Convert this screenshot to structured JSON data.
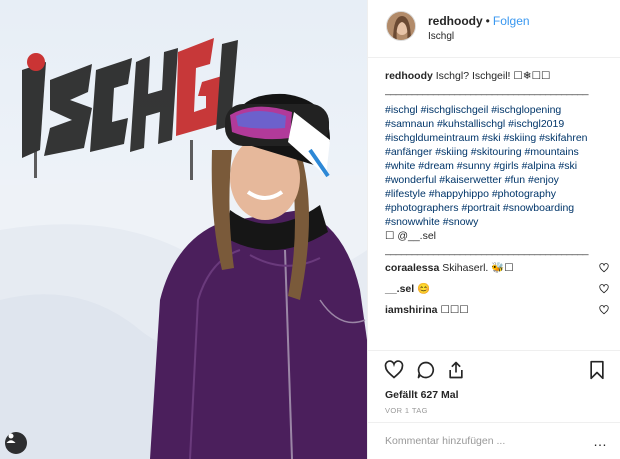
{
  "post": {
    "photo_icon": "person-tag-icon"
  },
  "header": {
    "username": "redhoody",
    "separator": "•",
    "follow_label": "Folgen",
    "location": "Ischgl"
  },
  "caption": {
    "username": "redhoody",
    "text": "Ischgl? Ischgeil! ☐❄☐☐",
    "divider_top": "______________________________________",
    "hashtags": "#ischgl #ischglischgeil #ischglopening #samnaun #kuhstallischgl #ischgl2019 #ischgldumeintraum #ski #skiing #skifahren #anfänger #skiing #skitouring #mountains #white #dream #sunny #girls #alpina #ski #wonderful #kaiserwetter #fun #enjoy #lifestyle #happyhippo #photography #photographers #portrait #snowboarding #snowwhite #snowy",
    "mention": "☐ @__.sel",
    "divider_bottom": "______________________________________"
  },
  "comments": [
    {
      "username": "coraalessa",
      "text": "Skihaserl. 🐝☐"
    },
    {
      "username": "__.sel",
      "text": "😊"
    },
    {
      "username": "iamshirina",
      "text": "☐☐☐"
    }
  ],
  "actions": {
    "icons": [
      "heart-icon",
      "comment-icon",
      "share-icon",
      "bookmark-icon"
    ],
    "likes": "Gefällt 627 Mal",
    "timestamp": "VOR 1 TAG"
  },
  "add_comment": {
    "placeholder": "Kommentar hinzufügen ...",
    "more": "…"
  },
  "sign_text": "ISCHGL"
}
